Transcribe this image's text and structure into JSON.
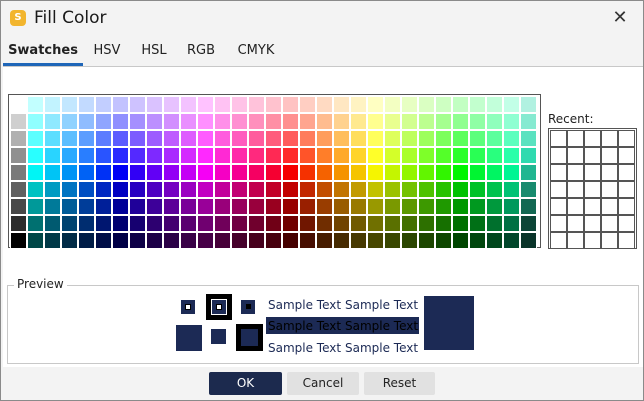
{
  "window": {
    "title": "Fill Color",
    "app_icon_letter": "S"
  },
  "tabs": [
    {
      "label": "Swatches",
      "active": true
    },
    {
      "label": "HSV"
    },
    {
      "label": "HSL"
    },
    {
      "label": "RGB"
    },
    {
      "label": "CMYK"
    }
  ],
  "swatches": {
    "selected_color": "#1c2a55",
    "columns": 31,
    "rows": 9
  },
  "recent": {
    "label": "Recent:",
    "rows": 7,
    "columns": 5
  },
  "preview": {
    "label": "Preview",
    "sample_text": "Sample Text",
    "selected_color": "#1c2a55"
  },
  "buttons": {
    "ok": "OK",
    "cancel": "Cancel",
    "reset": "Reset"
  }
}
